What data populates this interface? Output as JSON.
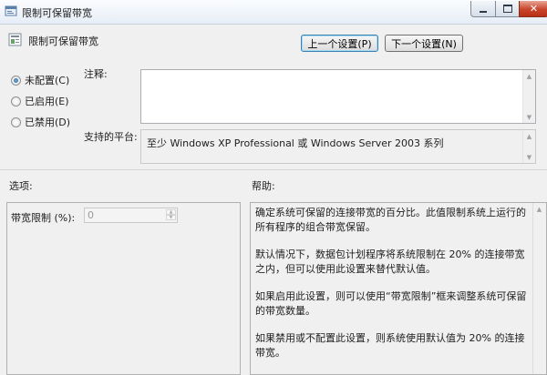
{
  "window": {
    "title": "限制可保留带宽"
  },
  "header": {
    "setting_name": "限制可保留带宽",
    "prev_button": "上一个设置(P)",
    "next_button": "下一个设置(N)"
  },
  "state_options": [
    {
      "label": "未配置(C)",
      "checked": true
    },
    {
      "label": "已启用(E)",
      "checked": false
    },
    {
      "label": "已禁用(D)",
      "checked": false
    }
  ],
  "comment": {
    "label": "注释:",
    "value": ""
  },
  "platform": {
    "label": "支持的平台:",
    "value": "至少 Windows XP Professional 或 Windows Server 2003 系列"
  },
  "options": {
    "label": "选项:",
    "bandwidth_label": "带宽限制 (%):",
    "bandwidth_value": "0"
  },
  "help": {
    "label": "帮助:",
    "paragraphs": [
      "确定系统可保留的连接带宽的百分比。此值限制系统上运行的所有程序的组合带宽保留。",
      "默认情况下，数据包计划程序将系统限制在 20% 的连接带宽之内，但可以使用此设置来替代默认值。",
      "如果启用此设置，则可以使用“带宽限制”框来调整系统可保留的带宽数量。",
      "如果禁用或不配置此设置，则系统使用默认值为 20% 的连接带宽。"
    ]
  },
  "colors": {
    "accent": "#3c7fb1",
    "window_bg": "#f0f0f0",
    "close_button": "#c8442b"
  },
  "icons": [
    "policy-app-icon",
    "policy-setting-icon",
    "minimize-icon",
    "maximize-icon",
    "close-icon"
  ]
}
